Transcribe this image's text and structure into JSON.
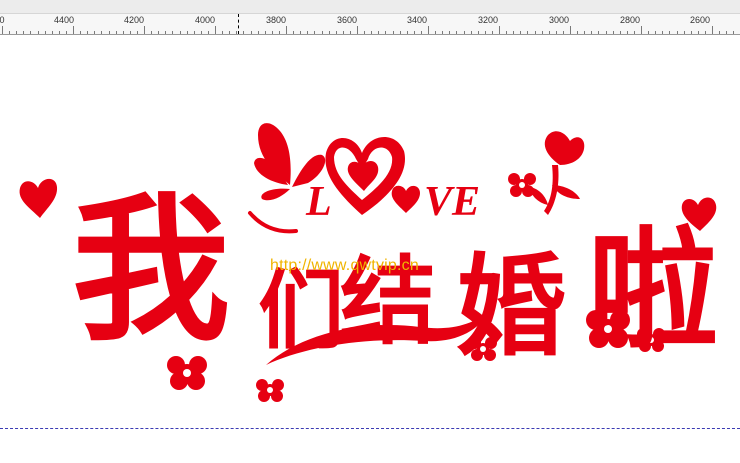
{
  "ruler": {
    "labels": [
      "0",
      "4400",
      "4200",
      "4000",
      "3800",
      "3600",
      "3400",
      "3200",
      "3000",
      "2800",
      "2600"
    ]
  },
  "artwork": {
    "main_text": "我们结婚啦",
    "love_text": "LOVE",
    "watermark": "http://www.qwtvip.cn",
    "accent_color": "#e60012",
    "watermark_color": "#f0b400"
  }
}
